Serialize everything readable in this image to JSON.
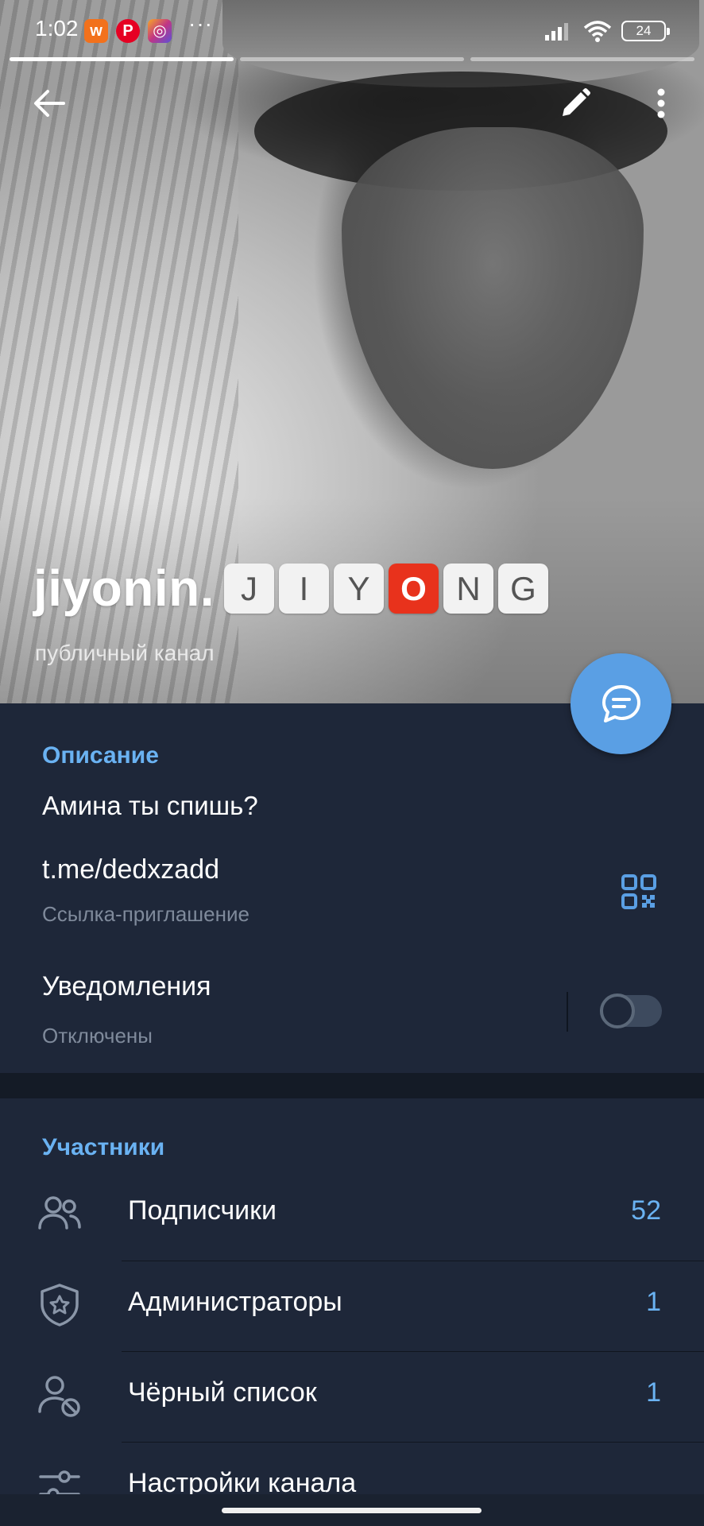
{
  "status_bar": {
    "time": "1:02",
    "apps": [
      {
        "icon": "w-app-icon",
        "glyph": "w",
        "color": "#f2711c"
      },
      {
        "icon": "pinterest-icon",
        "glyph": "P",
        "color": "#e60023"
      },
      {
        "icon": "instagram-icon",
        "glyph": "◎",
        "color": "#c13584"
      }
    ],
    "more": "···",
    "battery": "24"
  },
  "header": {
    "channel_name": "jiyonin.",
    "name_tiles": [
      "J",
      "I",
      "Y",
      "O",
      "N",
      "G"
    ],
    "highlighted_tile_index": 3,
    "channel_type": "публичный канал"
  },
  "info": {
    "section_title": "Описание",
    "description": "Амина ты спишь?",
    "link": "t.me/dedxzadd",
    "link_subtitle": "Ссылка-приглашение",
    "notifications_label": "Уведомления",
    "notifications_status": "Отключены",
    "notifications_enabled": false
  },
  "members": {
    "section_title": "Участники",
    "rows": [
      {
        "label": "Подписчики",
        "count": "52",
        "icon": "subscribers-icon"
      },
      {
        "label": "Администраторы",
        "count": "1",
        "icon": "admin-shield-icon"
      },
      {
        "label": "Чёрный список",
        "count": "1",
        "icon": "blocked-user-icon"
      },
      {
        "label": "Настройки канала",
        "count": "",
        "icon": "settings-sliders-icon"
      }
    ]
  },
  "colors": {
    "accent": "#6ab2f2",
    "fab": "#5a9fe4",
    "card_bg": "#1e2739",
    "highlight_tile": "#e8321c"
  }
}
